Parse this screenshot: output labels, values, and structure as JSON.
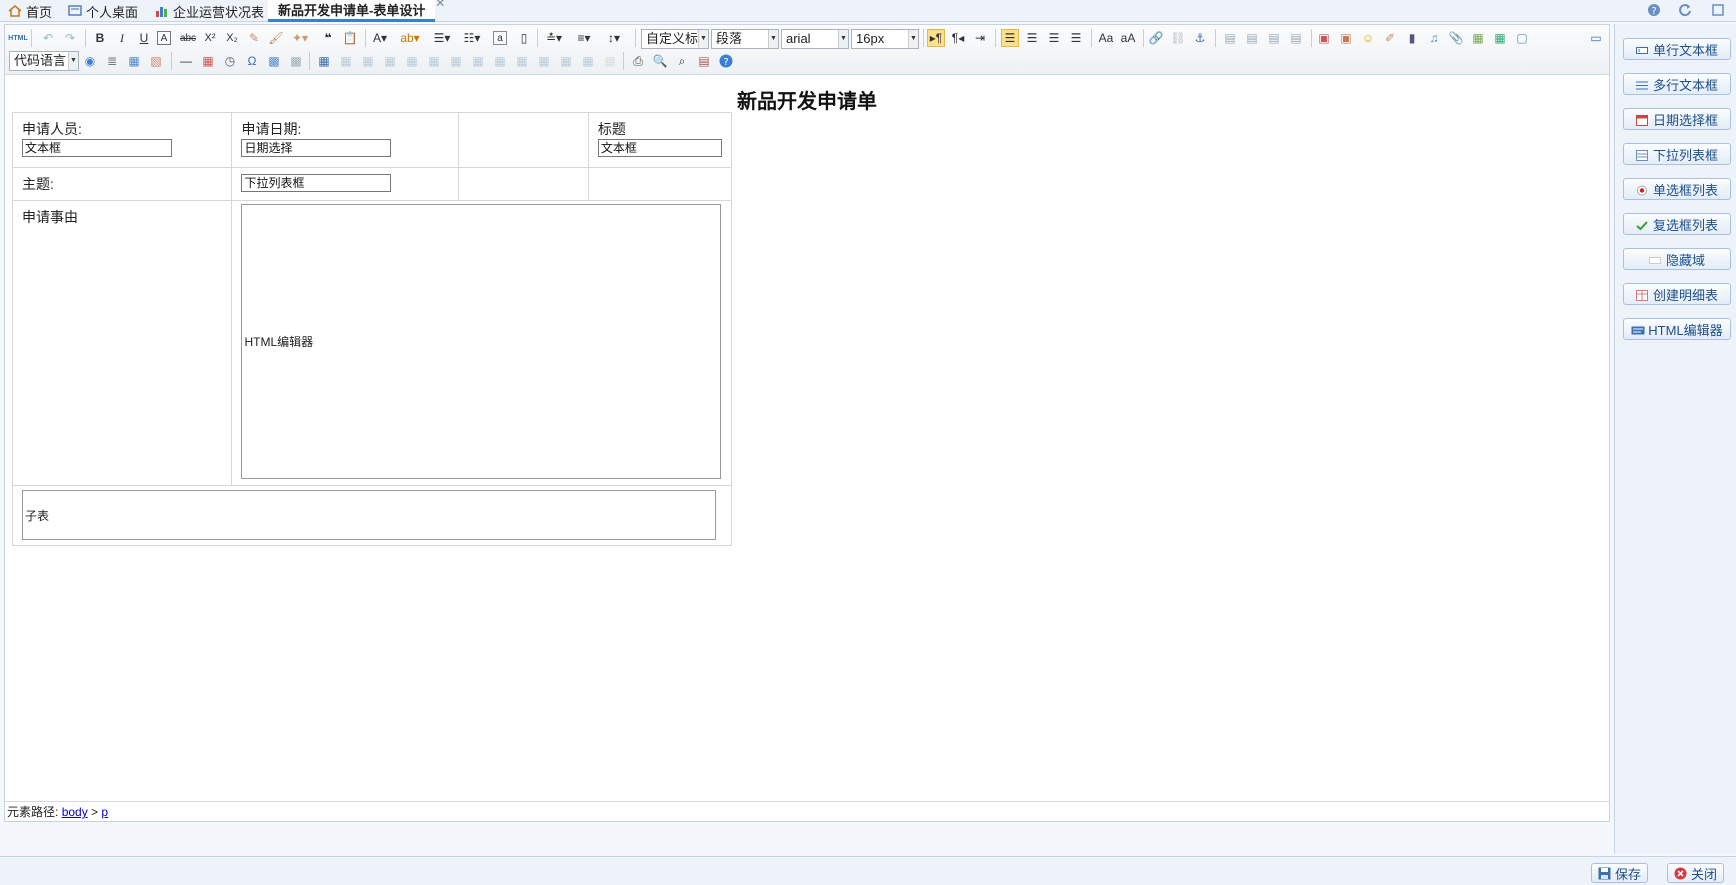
{
  "tabs": [
    {
      "label": "首页",
      "icon": "home-icon"
    },
    {
      "label": "个人桌面",
      "icon": "desktop-icon"
    },
    {
      "label": "企业运营状况表",
      "icon": "bar-chart-icon"
    },
    {
      "label": "新品开发申请单-表单设计",
      "active": true
    }
  ],
  "toolbar": {
    "html_label": "HTML",
    "style_select": "自定义标",
    "paragraph_select": "段落",
    "font_select": "arial",
    "size_select": "16px",
    "code_lang_select": "代码语言"
  },
  "form": {
    "title": "新品开发申请单",
    "applicant_label": "申请人员:",
    "applicant_value": "文本框",
    "date_label": "申请日期:",
    "date_value": "日期选择",
    "title_label": "标题",
    "title_value": "文本框",
    "subject_label": "主题:",
    "subject_value": "下拉列表框",
    "reason_label": "申请事由",
    "reason_value": "HTML编辑器",
    "subtable_value": "子表"
  },
  "statusbar": {
    "prefix": "元素路径:",
    "body_link": "body",
    "sep": " > ",
    "p_link": "p"
  },
  "side_buttons": [
    {
      "label": "单行文本框",
      "icon": "textbox-icon"
    },
    {
      "label": "多行文本框",
      "icon": "textarea-icon"
    },
    {
      "label": "日期选择框",
      "icon": "calendar-icon"
    },
    {
      "label": "下拉列表框",
      "icon": "dropdown-icon"
    },
    {
      "label": "单选框列表",
      "icon": "radio-icon"
    },
    {
      "label": "复选框列表",
      "icon": "checkbox-icon"
    },
    {
      "label": "隐藏域",
      "icon": "hidden-field-icon"
    },
    {
      "label": "创建明细表",
      "icon": "detail-table-icon"
    },
    {
      "label": "HTML编辑器",
      "icon": "html-editor-icon"
    }
  ],
  "bottom": {
    "save_label": "保存",
    "close_label": "关闭"
  },
  "colors": {
    "accent": "#3b7fd4",
    "active_tool": "#ffe08a",
    "close_red": "#d9363e"
  }
}
